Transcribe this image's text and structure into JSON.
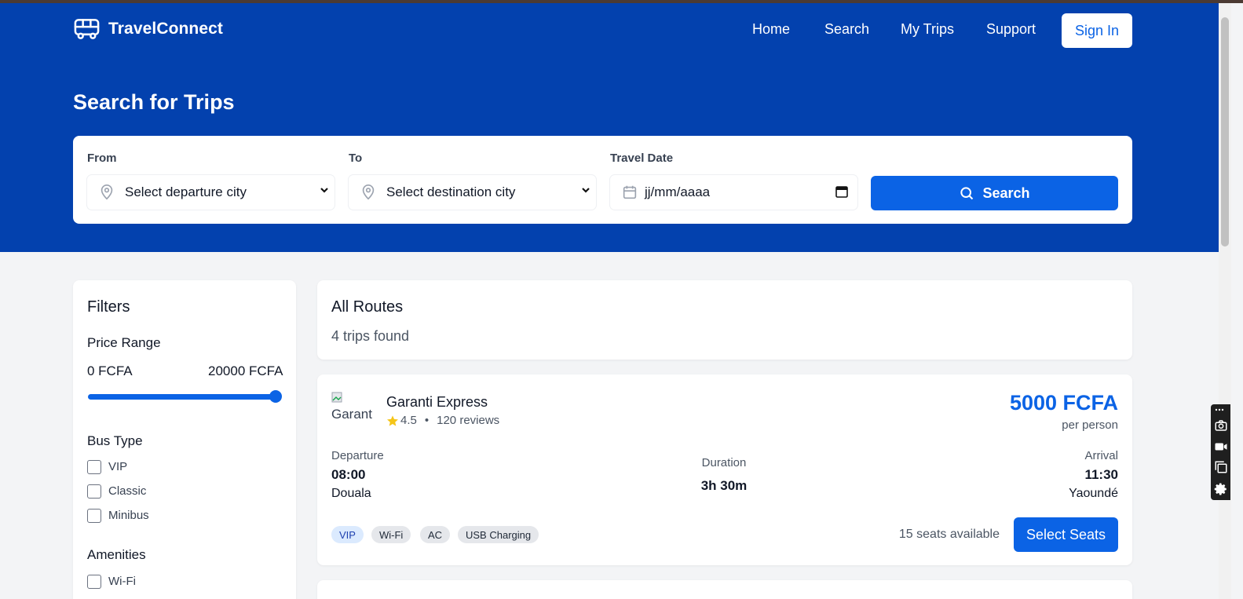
{
  "app": {
    "name": "TravelConnect",
    "brand_color": "#0341ae",
    "accent_color": "#0b63e5"
  },
  "nav": {
    "links": [
      "Home",
      "Search",
      "My Trips",
      "Support"
    ],
    "signin": "Sign In"
  },
  "hero": {
    "title": "Search for Trips"
  },
  "search": {
    "from_label": "From",
    "from_value": "Select departure city",
    "to_label": "To",
    "to_value": "Select destination city",
    "date_label": "Travel Date",
    "date_placeholder": "jj/mm/aaaa",
    "button": "Search"
  },
  "filters": {
    "title": "Filters",
    "price_range_label": "Price Range",
    "price_min": "0 FCFA",
    "price_max": "20000 FCFA",
    "price_slider_fraction": 1.0,
    "bus_type_label": "Bus Type",
    "bus_types": [
      "VIP",
      "Classic",
      "Minibus"
    ],
    "amenities_label": "Amenities",
    "amenities": [
      "Wi-Fi"
    ]
  },
  "routes": {
    "title": "All Routes",
    "count": "4 trips found"
  },
  "trip": {
    "logo_alt": "Garant",
    "company": "Garanti Express",
    "rating": "4.5",
    "reviews": "120 reviews",
    "price": "5000 FCFA",
    "per": "per person",
    "departure_label": "Departure",
    "departure_time": "08:00",
    "departure_city": "Douala",
    "duration_label": "Duration",
    "duration": "3h 30m",
    "arrival_label": "Arrival",
    "arrival_time": "11:30",
    "arrival_city": "Yaoundé",
    "badges": [
      "VIP",
      "Wi-Fi",
      "AC",
      "USB Charging"
    ],
    "seats": "15 seats available",
    "select_button": "Select Seats"
  }
}
